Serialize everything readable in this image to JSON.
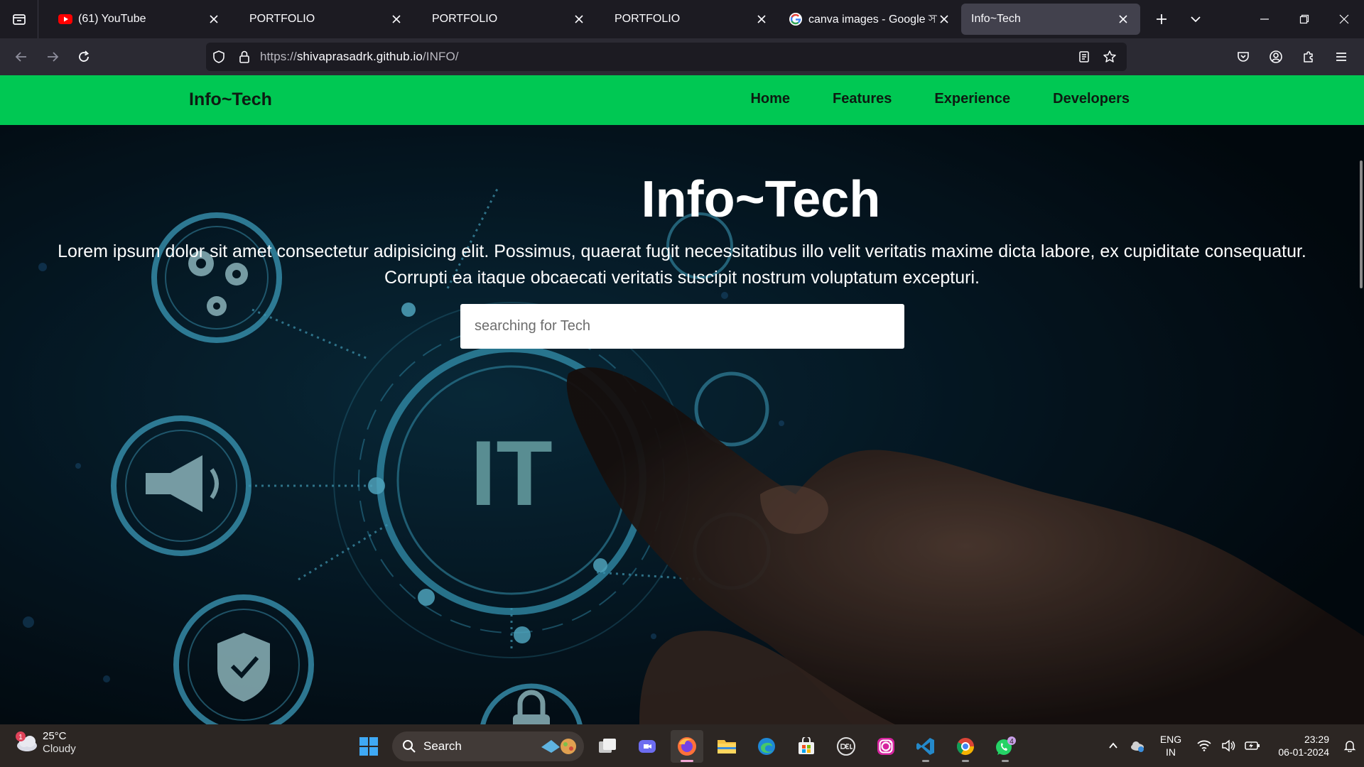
{
  "browser": {
    "tabs": [
      {
        "title": "(61) YouTube",
        "favicon": "youtube-icon",
        "active": false
      },
      {
        "title": "PORTFOLIO",
        "favicon": "",
        "active": false
      },
      {
        "title": "PORTFOLIO",
        "favicon": "",
        "active": false
      },
      {
        "title": "PORTFOLIO",
        "favicon": "",
        "active": false
      },
      {
        "title": "canva images - Google সার্চ",
        "favicon": "google-icon",
        "active": false
      },
      {
        "title": "Info~Tech",
        "favicon": "",
        "active": true
      }
    ],
    "url": {
      "scheme": "https://",
      "host": "shivaprasadrk.github.io",
      "path": "/INFO/"
    }
  },
  "site": {
    "brand": "Info~Tech",
    "nav": [
      "Home",
      "Features",
      "Experience",
      "Developers"
    ],
    "hero": {
      "title": "Info~Tech",
      "text": "Lorem ipsum dolor sit amet consectetur adipisicing elit. Possimus, quaerat fugit necessitatibus illo velit veritatis maxime dicta labore, ex cupiditate consequatur. Corrupti ea itaque obcaecati veritatis suscipit nostrum voluptatum excepturi.",
      "search_placeholder": "searching for Tech",
      "image_text": "IT"
    },
    "colors": {
      "accent": "#00c853"
    }
  },
  "taskbar": {
    "weather": {
      "temp": "25°C",
      "condition": "Cloudy",
      "badge": "1"
    },
    "search_label": "Search",
    "whatsapp_badge": "4",
    "lang_top": "ENG",
    "lang_bottom": "IN",
    "time": "23:29",
    "date": "06-01-2024"
  }
}
